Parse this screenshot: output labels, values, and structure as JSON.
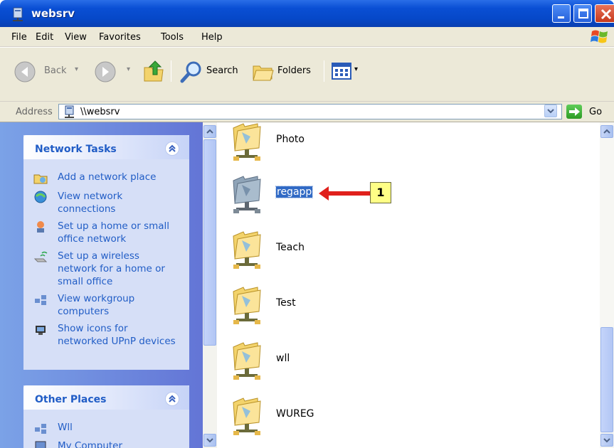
{
  "window": {
    "title": "websrv"
  },
  "menu": [
    "File",
    "Edit",
    "View",
    "Favorites",
    "Tools",
    "Help"
  ],
  "toolbar": {
    "back_label": "Back",
    "search_label": "Search",
    "folders_label": "Folders"
  },
  "address": {
    "label": "Address",
    "value": "\\\\websrv",
    "go_label": "Go"
  },
  "network_tasks": {
    "title": "Network Tasks",
    "items": [
      {
        "label": "Add a network place",
        "icon": "add-network-place-icon"
      },
      {
        "label": "View network connections",
        "icon": "network-connections-icon"
      },
      {
        "label": "Set up a home or small office network",
        "icon": "home-network-icon"
      },
      {
        "label": "Set up a wireless network for a home or small office",
        "icon": "wireless-icon"
      },
      {
        "label": "View workgroup computers",
        "icon": "workgroup-icon"
      },
      {
        "label": "Show icons for networked UPnP devices",
        "icon": "upnp-icon"
      }
    ]
  },
  "other_places": {
    "title": "Other Places",
    "items": [
      {
        "label": "Wll",
        "icon": "workgroup-icon"
      },
      {
        "label": "My Computer",
        "icon": "my-computer-icon"
      }
    ]
  },
  "folders": [
    {
      "label": "Photo",
      "selected": false
    },
    {
      "label": "regapp",
      "selected": true
    },
    {
      "label": "Teach",
      "selected": false
    },
    {
      "label": "Test",
      "selected": false
    },
    {
      "label": "wll",
      "selected": false
    },
    {
      "label": "WUREG",
      "selected": false
    }
  ],
  "callout": {
    "number": "1",
    "color": "#ffff86",
    "arrow_color": "#e0201c"
  },
  "colors": {
    "titlebar": "#0a4fd4",
    "task_link": "#215dc6",
    "selection": "#316ac5",
    "chrome": "#ece9d8"
  }
}
